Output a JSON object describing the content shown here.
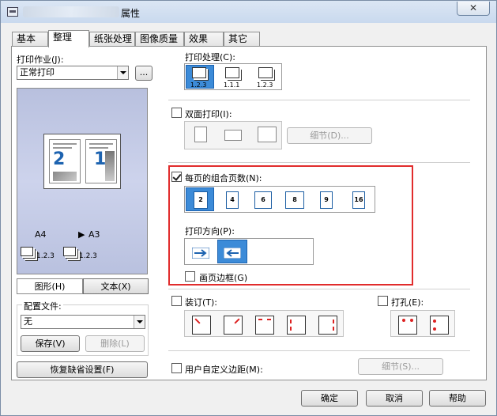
{
  "window": {
    "title": "属性",
    "close_label": "✕"
  },
  "tabs": [
    "基本",
    "整理",
    "纸张处理",
    "图像质量",
    "效果",
    "其它"
  ],
  "left": {
    "job_label": "打印作业(J):",
    "job_value": "正常打印",
    "job_more": "...",
    "preview": {
      "paper_from": "A4",
      "paper_to": "A3",
      "collate_a": "1.2.3",
      "collate_b": "1.2.3",
      "num_left": "2",
      "num_right": "1"
    },
    "view_tabs": [
      "图形(H)",
      "文本(X)"
    ],
    "config_label": "配置文件:",
    "config_value": "无",
    "save_btn": "保存(V)",
    "delete_btn": "删除(L)",
    "restore_btn": "恢复缺省设置(F)"
  },
  "right": {
    "print_process_label": "打印处理(C):",
    "print_process_options": [
      "1.2.3",
      "1.1.1",
      "1.2.3"
    ],
    "duplex_label": "双面打印(I):",
    "duplex_detail_btn": "细节(D)...",
    "nup_label": "每页的组合页数(N):",
    "nup_options": [
      "2",
      "4",
      "6",
      "8",
      "9",
      "16"
    ],
    "direction_label": "打印方向(P):",
    "border_label": "画页边框(G)",
    "staple_label": "装订(T):",
    "punch_label": "打孔(E):",
    "margin_label": "用户自定义边距(M):",
    "margin_detail_btn": "细节(S)..."
  },
  "footer": {
    "ok": "确定",
    "cancel": "取消",
    "help": "帮助"
  },
  "colors": {
    "accent": "#3c8bd8",
    "highlight": "#e12c2c",
    "arrow": "#1d63b0"
  }
}
